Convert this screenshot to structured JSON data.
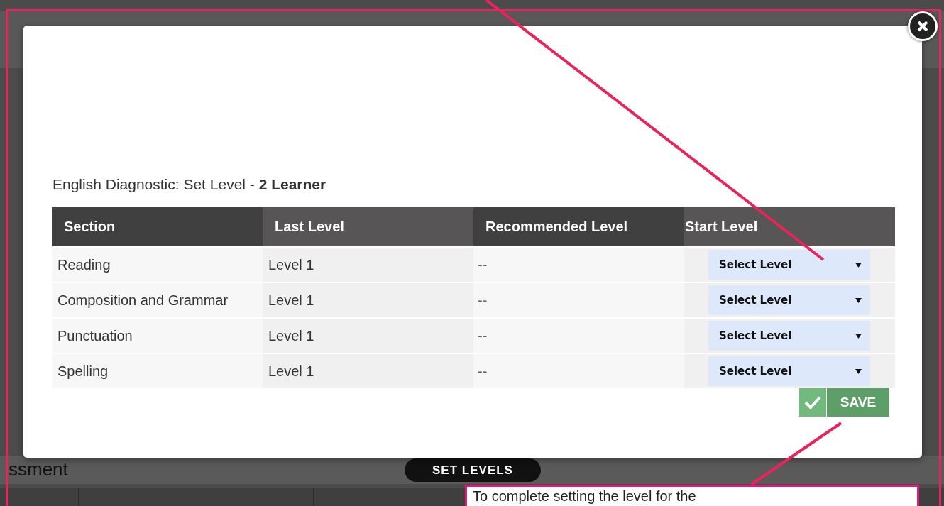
{
  "backdrop": {
    "heading_fragment": "ssment",
    "button": "SET LEVELS"
  },
  "dialog": {
    "title": "English Diagnostic: Set Level - **2 Learner**",
    "table": {
      "columns": [
        "Section",
        "Last Level",
        "Recommended Level",
        "Start Level"
      ],
      "rows": [
        {
          "section": "Reading",
          "last_level": "Level 1",
          "recommended_level": "--",
          "start_level": "Select Level"
        },
        {
          "section": "Composition and Grammar",
          "last_level": "Level 1",
          "recommended_level": "--",
          "start_level": "Select Level"
        },
        {
          "section": "Punctuation",
          "last_level": "Level 1",
          "recommended_level": "--",
          "start_level": "Select Level"
        },
        {
          "section": "Spelling",
          "last_level": "Level 1",
          "recommended_level": "--",
          "start_level": "Select Level"
        }
      ]
    },
    "save_button": "SAVE"
  },
  "callout": {
    "text": "To complete setting the level for the"
  }
}
